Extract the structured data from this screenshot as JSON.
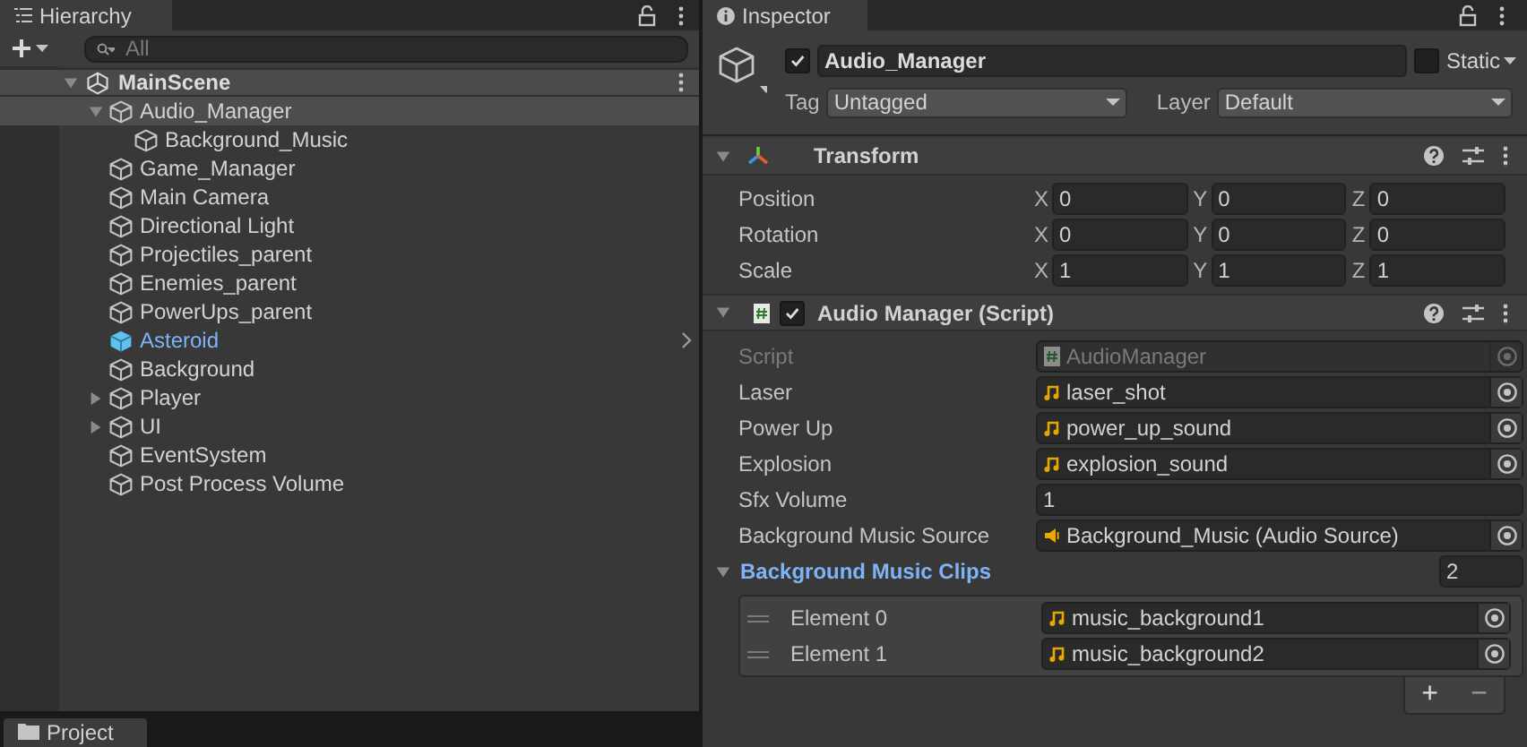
{
  "hierarchy": {
    "title": "Hierarchy",
    "search": {
      "placeholder": "All"
    },
    "scene": {
      "name": "MainScene",
      "expanded": true,
      "children": [
        {
          "name": "Audio_Manager",
          "selected": true,
          "expanded": true,
          "kind": "object",
          "children": [
            {
              "name": "Background_Music",
              "selected": false,
              "kind": "object"
            }
          ]
        },
        {
          "name": "Game_Manager",
          "selected": false,
          "kind": "object"
        },
        {
          "name": "Main Camera",
          "selected": false,
          "kind": "object"
        },
        {
          "name": "Directional Light",
          "selected": false,
          "kind": "object"
        },
        {
          "name": "Projectiles_parent",
          "selected": false,
          "kind": "object"
        },
        {
          "name": "Enemies_parent",
          "selected": false,
          "kind": "object"
        },
        {
          "name": "PowerUps_parent",
          "selected": false,
          "kind": "object"
        },
        {
          "name": "Asteroid",
          "selected": false,
          "kind": "prefab"
        },
        {
          "name": "Background",
          "selected": false,
          "kind": "object"
        },
        {
          "name": "Player",
          "selected": false,
          "expanded": false,
          "kind": "object"
        },
        {
          "name": "UI",
          "selected": false,
          "expanded": false,
          "kind": "object"
        },
        {
          "name": "EventSystem",
          "selected": false,
          "kind": "object"
        },
        {
          "name": "Post Process Volume",
          "selected": false,
          "kind": "object"
        }
      ]
    }
  },
  "project_tab": {
    "title": "Project"
  },
  "inspector": {
    "title": "Inspector",
    "object": {
      "active": true,
      "name": "Audio_Manager",
      "static": false,
      "static_label": "Static",
      "tag_label": "Tag",
      "tag": "Untagged",
      "layer_label": "Layer",
      "layer": "Default"
    },
    "transform": {
      "title": "Transform",
      "expanded": true,
      "rows": [
        {
          "label": "Position",
          "axes": [
            {
              "axis": "X",
              "value": "0"
            },
            {
              "axis": "Y",
              "value": "0"
            },
            {
              "axis": "Z",
              "value": "0"
            }
          ]
        },
        {
          "label": "Rotation",
          "axes": [
            {
              "axis": "X",
              "value": "0"
            },
            {
              "axis": "Y",
              "value": "0"
            },
            {
              "axis": "Z",
              "value": "0"
            }
          ]
        },
        {
          "label": "Scale",
          "axes": [
            {
              "axis": "X",
              "value": "1"
            },
            {
              "axis": "Y",
              "value": "1"
            },
            {
              "axis": "Z",
              "value": "1"
            }
          ]
        }
      ]
    },
    "script": {
      "title": "Audio Manager (Script)",
      "expanded": true,
      "enabled": true,
      "fields": [
        {
          "label": "Script",
          "kind": "script",
          "value": "AudioManager",
          "disabled": true
        },
        {
          "label": "Laser",
          "kind": "clip",
          "value": "laser_shot",
          "disabled": false
        },
        {
          "label": "Power Up",
          "kind": "clip",
          "value": "power_up_sound",
          "disabled": false
        },
        {
          "label": "Explosion",
          "kind": "clip",
          "value": "explosion_sound",
          "disabled": false
        },
        {
          "label": "Sfx Volume",
          "kind": "number",
          "value": "1",
          "disabled": false
        },
        {
          "label": "Background Music Source",
          "kind": "source",
          "value": "Background_Music (Audio Source)",
          "disabled": false
        }
      ],
      "list": {
        "label": "Background Music Clips",
        "expanded": true,
        "size": "2",
        "elements": [
          {
            "label": "Element 0",
            "value": "music_background1"
          },
          {
            "label": "Element 1",
            "value": "music_background2"
          }
        ],
        "add": "+",
        "remove": "−"
      }
    }
  }
}
